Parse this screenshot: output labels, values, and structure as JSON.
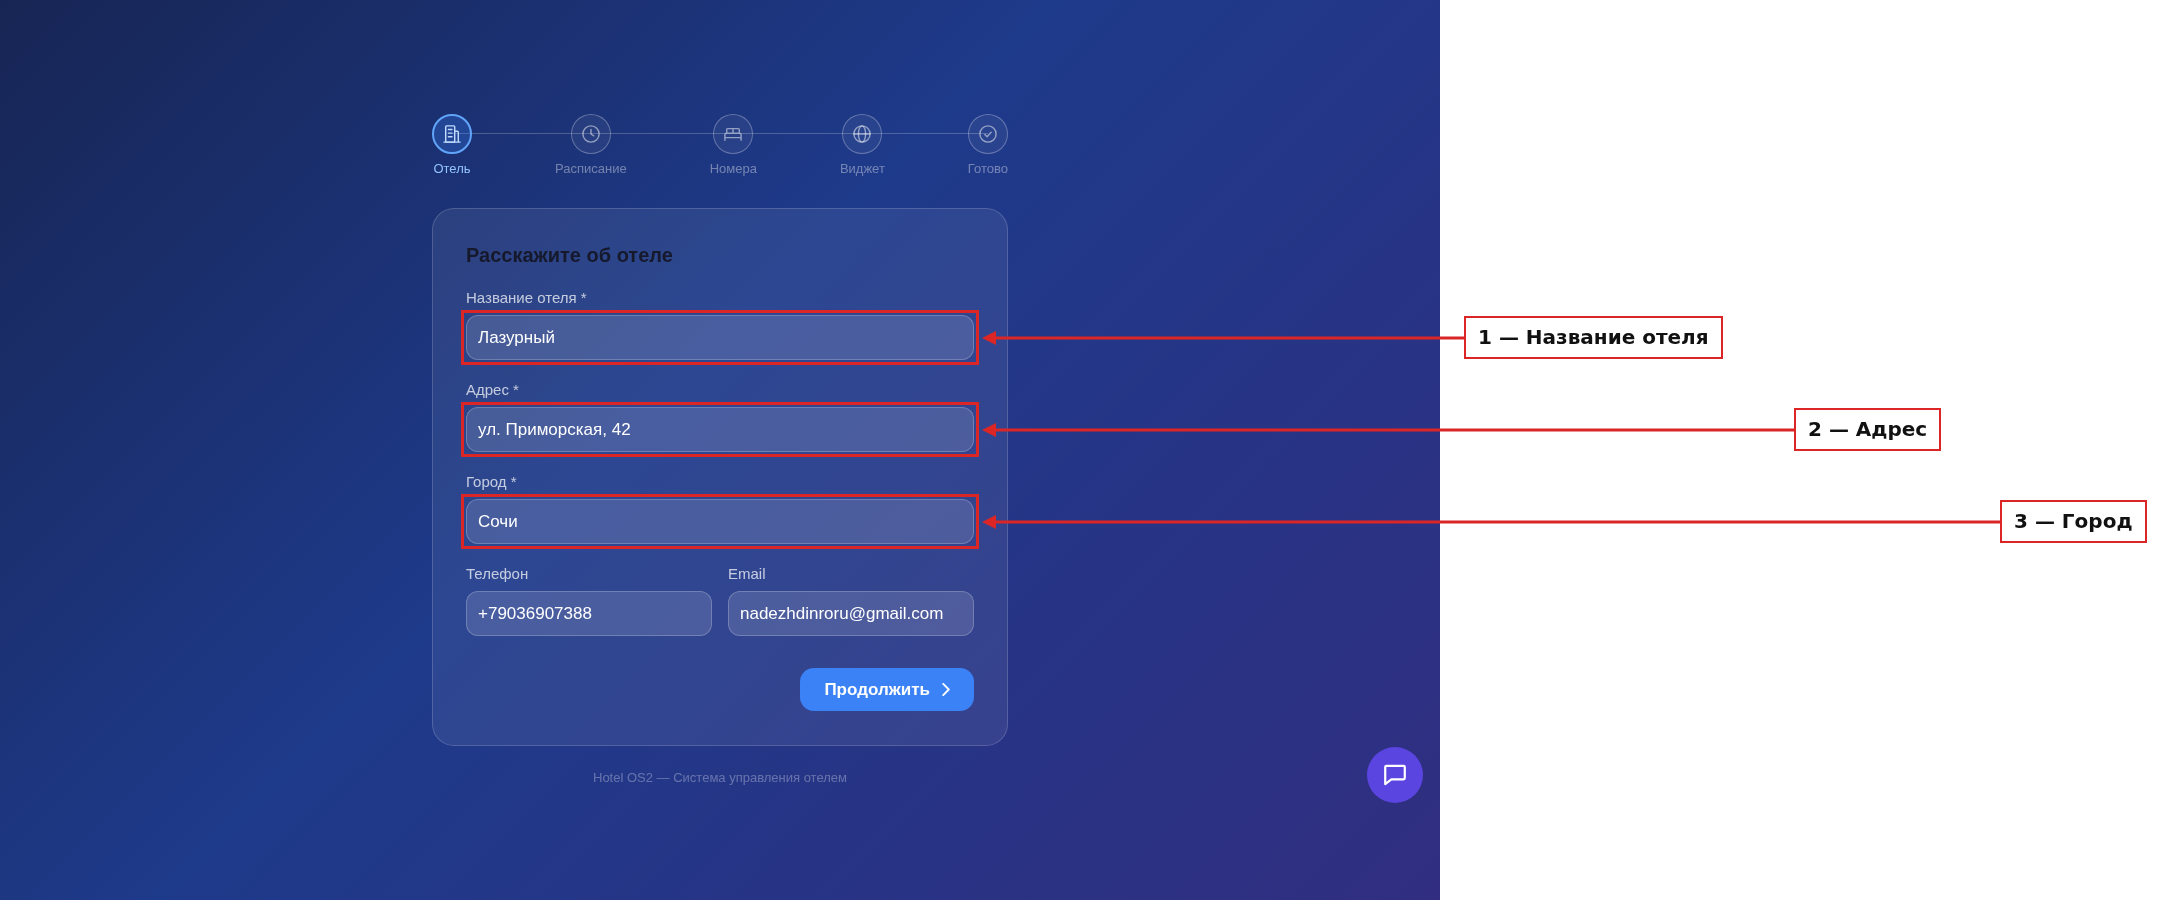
{
  "stepper": {
    "steps": [
      {
        "label": "Отель",
        "selected": true
      },
      {
        "label": "Расписание",
        "selected": false
      },
      {
        "label": "Номера",
        "selected": false
      },
      {
        "label": "Виджет",
        "selected": false
      },
      {
        "label": "Готово",
        "selected": false
      }
    ]
  },
  "form": {
    "title": "Расскажите об отеле",
    "rows": [
      {
        "fields": [
          {
            "label": "Название отеля *",
            "value": "Лазурный"
          }
        ]
      },
      {
        "fields": [
          {
            "label": "Адрес *",
            "value": "ул. Приморская, 42"
          }
        ]
      },
      {
        "fields": [
          {
            "label": "Город *",
            "value": "Сочи"
          }
        ]
      },
      {
        "fields": [
          {
            "label": "Телефон",
            "value": "+79036907388"
          },
          {
            "label": "Email",
            "value": "nadezhdinroru@gmail.com"
          }
        ]
      }
    ],
    "submit_button": {
      "label": "Продолжить"
    }
  },
  "footer": "Hotel OS2 — Система управления отелем",
  "annotations": [
    {
      "label": "1 — Название отеля"
    },
    {
      "label": "2 — Адрес"
    },
    {
      "label": "3 — Город"
    }
  ]
}
